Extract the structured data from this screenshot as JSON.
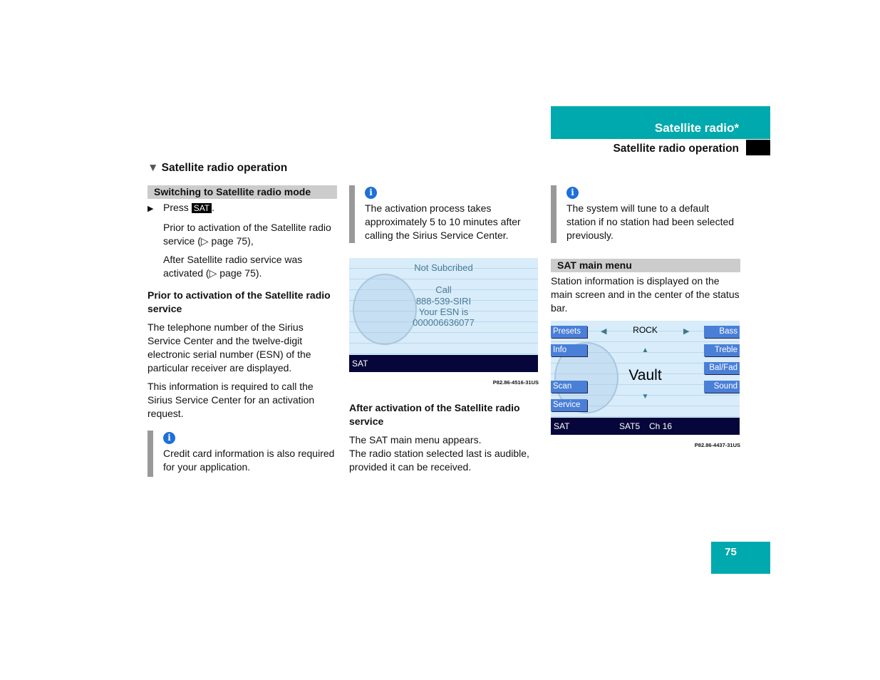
{
  "header": {
    "chapter": "Satellite radio*",
    "section": "Satellite radio operation"
  },
  "section_title": "Satellite radio operation",
  "col1": {
    "bar": "Switching to Satellite radio mode",
    "press": "Press",
    "key": "SAT",
    "p1": "Prior to activation of the Satellite radio service (▷ page 75),",
    "p2": "After Satellite radio service was activated (▷ page 75).",
    "sub": "Prior to activation of the Satellite radio service",
    "p3": "The telephone number of the Sirius Service Center and the twelve-digit electronic serial number (ESN) of the particular receiver are displayed.",
    "p4": "This information is required to call the Sirius Service Center for an activation request.",
    "note": "Credit card information is also required for your application."
  },
  "col2": {
    "note": "The activation process takes approximately 5 to 10 minutes after calling the Sirius Service Center.",
    "screen": {
      "line1": "Not Subcribed",
      "line2": "Call",
      "line3": "888-539-SIRI",
      "line4": "Your ESN is",
      "line5": "000006636077",
      "status": "SAT"
    },
    "fig": "P82.86-4516-31US",
    "sub": "After activation of the Satellite radio service",
    "p1": "The SAT main menu appears.",
    "p2": "The radio station selected last is audible, provided it can be received."
  },
  "col3": {
    "note": "The system will tune to a default station if no station had been selected previously.",
    "bar": "SAT main menu",
    "p1": "Station information is displayed on the main screen and in the center of the status bar.",
    "screen": {
      "left": [
        "Presets",
        "Info",
        "Scan",
        "Service"
      ],
      "right": [
        "Bass",
        "Treble",
        "Bal/Fad",
        "Sound"
      ],
      "category": "ROCK",
      "station": "Vault",
      "status": "SAT",
      "band": "SAT5",
      "channel": "Ch 16"
    },
    "fig": "P82.86-4437-31US"
  },
  "page_number": "75",
  "colors": {
    "accent": "#00a9ad",
    "info": "#1e6fd9"
  }
}
